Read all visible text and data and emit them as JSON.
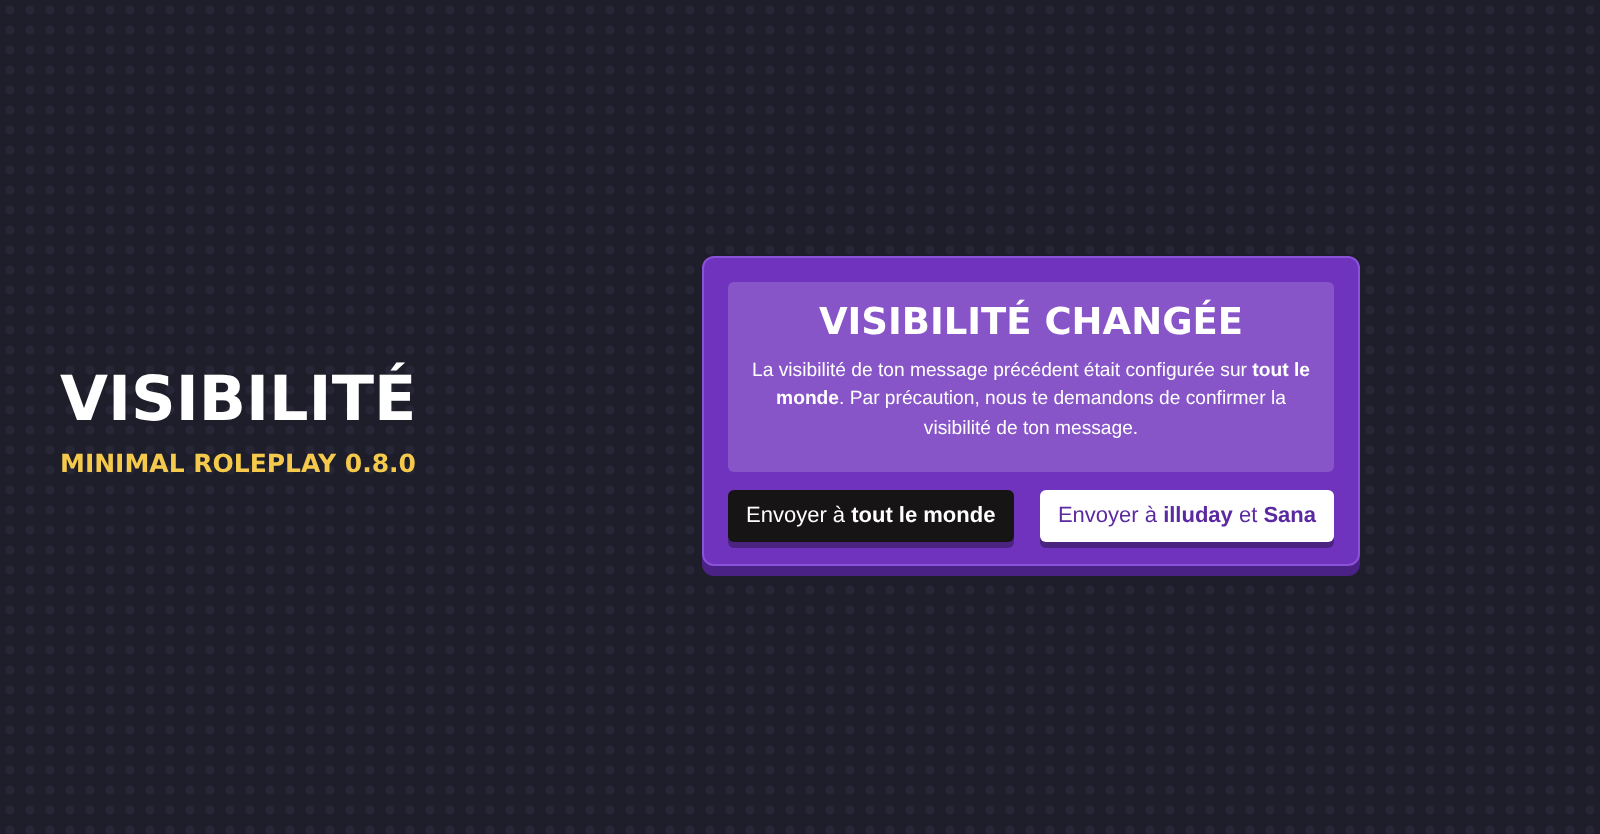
{
  "title": "VISIBILITÉ",
  "subtitle": "MINIMAL ROLEPLAY 0.8.0",
  "dialog": {
    "title": "VISIBILITÉ CHANGÉE",
    "message": "La visibilité de ton message précédent était configurée sur **tout le monde**. Par précaution, nous te demandons de confirmer la visibilité de ton message.",
    "buttons": [
      {
        "label": "Envoyer à **tout le monde**",
        "kind": "dark"
      },
      {
        "label": "Envoyer à **illuday** et **Sana**",
        "kind": "light"
      }
    ]
  }
}
